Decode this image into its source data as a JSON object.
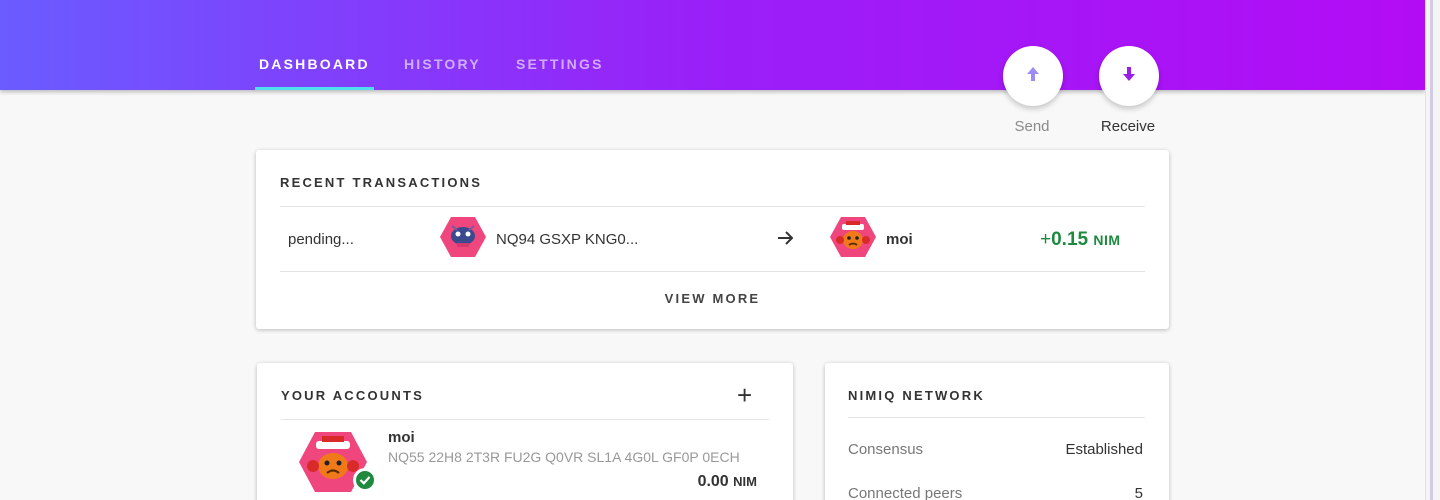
{
  "nav": {
    "tabs": [
      {
        "label": "DASHBOARD",
        "active": true
      },
      {
        "label": "HISTORY",
        "active": false
      },
      {
        "label": "SETTINGS",
        "active": false
      }
    ]
  },
  "actions": {
    "send_label": "Send",
    "receive_label": "Receive",
    "send_icon": "arrow-up-icon",
    "receive_icon": "arrow-down-icon"
  },
  "recent_transactions": {
    "title": "RECENT TRANSACTIONS",
    "items": [
      {
        "status": "pending...",
        "from": "NQ94 GSXP KNG0...",
        "to": "moi",
        "amount_sign": "+",
        "amount_value": "0.15",
        "amount_unit": "NIM"
      }
    ],
    "view_more_label": "VIEW MORE"
  },
  "accounts": {
    "title": "YOUR ACCOUNTS",
    "add_label": "+",
    "items": [
      {
        "name": "moi",
        "address": "NQ55 22H8 2T3R FU2G Q0VR SL1A 4G0L GF0P 0ECH",
        "balance": "0.00",
        "unit": "NIM"
      }
    ]
  },
  "network": {
    "title": "NIMIQ NETWORK",
    "rows": [
      {
        "label": "Consensus",
        "value": "Established"
      },
      {
        "label": "Connected peers",
        "value": "5"
      }
    ]
  },
  "colors": {
    "header_start": "#6a5cff",
    "header_end": "#b30cf5",
    "tab_indicator": "#4fe0f0",
    "positive_amount": "#1f8a3f",
    "send_accent": "#9c8cf7",
    "receive_accent": "#9b1de8"
  }
}
